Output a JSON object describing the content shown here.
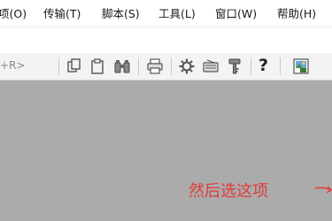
{
  "menubar": {
    "items": [
      {
        "label": "项(O)"
      },
      {
        "label": "传输(T)"
      },
      {
        "label": "脚本(S)"
      },
      {
        "label": "工具(L)"
      },
      {
        "label": "窗口(W)"
      },
      {
        "label": "帮助(H)"
      }
    ]
  },
  "toolbar": {
    "shortcut_text": "+R>",
    "help_glyph": "?",
    "icons": [
      "copy-icon",
      "paste-icon",
      "find-binoculars-icon",
      "print-icon",
      "settings-gear-icon",
      "keymap-icon",
      "key-icon",
      "help-icon",
      "screen-image-icon"
    ]
  },
  "annotation": {
    "text": "然后选这项",
    "color": "#e03a3a"
  },
  "colors": {
    "workspace_bg": "#ababab",
    "menubar_bg": "#ffffff",
    "toolbar_bg": "#f3f3f3"
  }
}
